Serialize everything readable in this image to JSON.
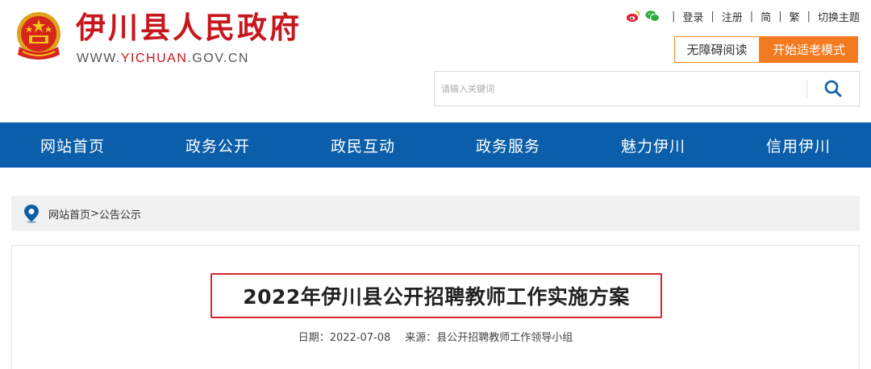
{
  "header": {
    "title": "伊川县人民政府",
    "domain_prefix": "WWW.",
    "domain_highlight": "YICHUAN",
    "domain_suffix": ".GOV.CN",
    "top_links": {
      "login": "登录",
      "register": "注册",
      "simplified": "简",
      "traditional": "繁",
      "switch_theme": "切换主题"
    },
    "accessibility_label": "无障碍阅读",
    "elder_mode_label": "开始适老模式",
    "search_placeholder": "请输入关键词"
  },
  "nav": {
    "items": [
      {
        "label": "网站首页"
      },
      {
        "label": "政务公开"
      },
      {
        "label": "政民互动"
      },
      {
        "label": "政务服务"
      },
      {
        "label": "魅力伊川"
      },
      {
        "label": "信用伊川"
      }
    ]
  },
  "breadcrumb": {
    "home": "网站首页",
    "separator": ">",
    "current": "公告公示"
  },
  "article": {
    "title": "2022年伊川县公开招聘教师工作实施方案",
    "date_label": "日期：",
    "date": "2022-07-08",
    "source_label": "来源：",
    "source": "县公开招聘教师工作领导小组"
  },
  "colors": {
    "brand_red": "#c8161d",
    "nav_blue": "#0b5ea9",
    "accent_orange": "#f47a1f",
    "highlight_border": "#d9262b"
  }
}
